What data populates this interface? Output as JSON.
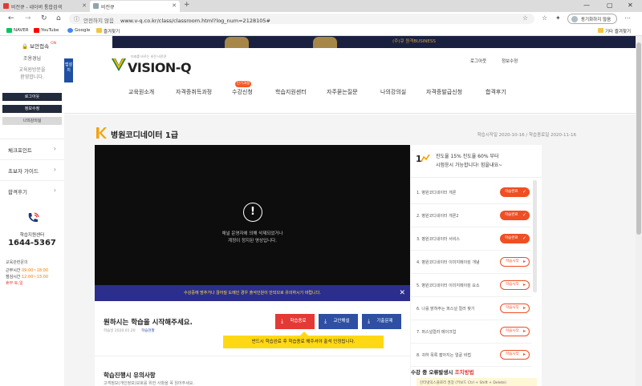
{
  "browser": {
    "tabs": [
      {
        "label": "비전큐 - 네이버 통합검색"
      },
      {
        "label": "비전큐"
      }
    ],
    "new_tab_symbol": "+",
    "window_controls": [
      "—",
      "▢",
      "✕"
    ],
    "address": {
      "not_secure": "안전하지 않음",
      "url": "www.v-q.co.kr/class/classroom.html?log_num=2128105#"
    },
    "sync_button": "동기화하지 않음",
    "favorites": [
      {
        "label": "NAVER",
        "color": "#03c75a"
      },
      {
        "label": "YouTube",
        "color": "#ff0000"
      },
      {
        "label": "Google",
        "color": "#4285f4"
      },
      {
        "label": "즐겨찾기",
        "color": "#f5c342"
      }
    ],
    "other_favorites": "기타 즐겨찾기"
  },
  "sidebar": {
    "security_check": "보안접속",
    "security_state": "ON",
    "info_lines": [
      "조용경님",
      "교육원방문을",
      "환영합니다."
    ],
    "buttons": [
      "로그아웃",
      "정보수정",
      "나의강의실"
    ],
    "menu": [
      "체크포인트",
      "초보자 가이드",
      "합격후기"
    ],
    "support_label": "학습지원센터",
    "phone": "1644-5367",
    "hours": {
      "title": "교육관련문의",
      "weekday_label": "근무시간",
      "weekday_hours": "09:00~18:00",
      "lunch_label": "점심시간",
      "lunch_hours": "12:00~13:00",
      "holiday": "휴무 토,일"
    }
  },
  "site": {
    "banner_text": "(주)큐 원격BUSINESS",
    "side_tab": "앱설치",
    "logo": {
      "tagline": "미래를 바꾸는 비전 비전큐",
      "brand": "VISION-Q"
    },
    "top_links": [
      "로그아웃",
      "정보수정"
    ],
    "gnb": [
      "교육원소개",
      "자격증취득과정",
      "수강신청",
      "학습지원센터",
      "자주묻는질문",
      "나의강의실",
      "자격증발급신청",
      "합격후기"
    ],
    "gnb_badge": "인기과정"
  },
  "course": {
    "title": "병원코디네이터 1급",
    "period_label": "학습시작일",
    "period_start": "2020-10-16",
    "period_end_label": "학습종료일",
    "period_end": "2020-11-16"
  },
  "video": {
    "warning_symbol": "!",
    "message_line1": "채널 운영자에 의해 삭제되었거나",
    "message_line2": "계정이 정지된 영상입니다.",
    "notice": "수강중에 멈추거나 끊어질 도메인 경우 출석인원이 안되므로 유의하시기 바랍니다."
  },
  "study": {
    "title": "원하시는 학습을 시작해주세요.",
    "meta_date": "학습일 2020.01.20",
    "meta_status": "학습현황",
    "buttons": [
      {
        "label": "학습종료",
        "color": "#e53935"
      },
      {
        "label": "교안해설",
        "color": "#2e4fa3"
      },
      {
        "label": "기출문제",
        "color": "#2e4fa3"
      }
    ],
    "tip": "반드시 학습완료 후 학습종료 해주셔야 출석 인정됩니다.",
    "caution_title": "학습진행시 유의사항",
    "caution_body": "고객정보(개인정보)보호를 위한 사항을 꼭 읽어주세요."
  },
  "progress": {
    "line1": "진도율 15% 진도율 60% 부터",
    "line2": "시험응시 가능합니다! 힘을내요~",
    "lessons": [
      {
        "num": "1.",
        "title": "병원코디네이터 개론",
        "status": "학습완료",
        "done": true
      },
      {
        "num": "2.",
        "title": "병원코디네이터 개론2",
        "status": "학습완료",
        "done": true
      },
      {
        "num": "3.",
        "title": "병원코디네이터 서비스",
        "status": "학습완료",
        "done": true
      },
      {
        "num": "4.",
        "title": "병원코디네이터 이미지메이킹 개념",
        "status": "학습시작",
        "done": false
      },
      {
        "num": "5.",
        "title": "병원코디네이터 이미지메이킹 요소",
        "status": "학습시작",
        "done": false
      },
      {
        "num": "6.",
        "title": "나를 밝혀주는 퍼스널 컬러 찾기",
        "status": "학습시작",
        "done": false
      },
      {
        "num": "7.",
        "title": "퍼스널컬러 메이크업",
        "status": "학습시작",
        "done": false
      },
      {
        "num": "8.",
        "title": "귀하 목록 짧아지는 얼굴 비법",
        "status": "학습시작",
        "done": false
      }
    ],
    "bottom_title": "수강 중 오류발생시",
    "bottom_title_red": "조치방법",
    "bottom_body": "인터넷익스플로러 권장 (키보드 Ctrl + Shift + Delete)"
  }
}
